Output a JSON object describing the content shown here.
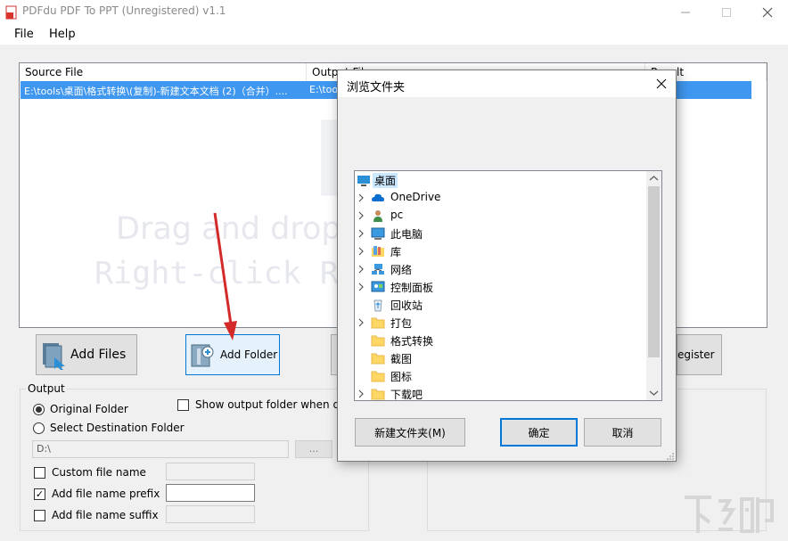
{
  "window": {
    "title": "PDFdu PDF To PPT (Unregistered) v1.1",
    "menu": [
      "File",
      "Help"
    ]
  },
  "file_list": {
    "columns": [
      "Source File",
      "Output File",
      "Result"
    ],
    "rows": [
      {
        "source": "E:\\tools\\桌面\\格式转换\\(复制)-新建文本文档 (2)（合并）....",
        "output": "E:\\too"
      }
    ],
    "watermark": [
      "Drag and drop y",
      "Right-click Re"
    ]
  },
  "buttons": {
    "add_files": "Add Files",
    "add_folder": "Add Folder",
    "register": "egister"
  },
  "output": {
    "group_label": "Output",
    "original_folder": "Original Folder",
    "select_destination": "Select Destination Folder",
    "show_output_folder": "Show output folder when don",
    "path": "D:\\",
    "browse": "...",
    "custom_file_name": "Custom file name",
    "add_prefix": "Add file name prefix",
    "add_suffix": "Add file name suffix",
    "prefix_checked": true
  },
  "dialog": {
    "title": "浏览文件夹",
    "tree": [
      {
        "label": "桌面",
        "icon": "desktop-icon",
        "expander": false,
        "selected": true
      },
      {
        "label": "OneDrive",
        "icon": "cloud-icon",
        "expander": true
      },
      {
        "label": "pc",
        "icon": "user-icon",
        "expander": true
      },
      {
        "label": "此电脑",
        "icon": "computer-icon",
        "expander": true
      },
      {
        "label": "库",
        "icon": "library-icon",
        "expander": true
      },
      {
        "label": "网络",
        "icon": "network-icon",
        "expander": true
      },
      {
        "label": "控制面板",
        "icon": "control-panel-icon",
        "expander": true
      },
      {
        "label": "回收站",
        "icon": "recycle-bin-icon",
        "expander": false
      },
      {
        "label": "打包",
        "icon": "folder-icon",
        "expander": true
      },
      {
        "label": "格式转换",
        "icon": "folder-icon",
        "expander": false
      },
      {
        "label": "截图",
        "icon": "folder-icon",
        "expander": false
      },
      {
        "label": "图标",
        "icon": "folder-icon",
        "expander": false
      },
      {
        "label": "下载吧",
        "icon": "folder-icon",
        "expander": true
      }
    ],
    "new_folder": "新建文件夹(M)",
    "ok": "确定",
    "cancel": "取消"
  },
  "colors": {
    "selection": "#3f97ef",
    "focus_border": "#0078d7",
    "arrow": "#d42a2a",
    "folder": "#ffd764"
  }
}
